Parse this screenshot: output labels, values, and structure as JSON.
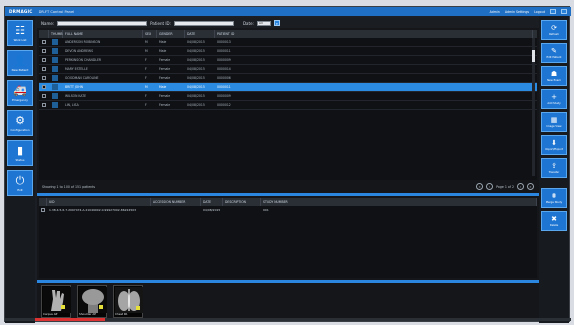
{
  "titlebar": {
    "app": "DRMAGIC",
    "subtitle": "DR-FT Control Panel",
    "right_items": [
      "Admin",
      "Admin Settings",
      "Logout"
    ]
  },
  "left_sidebar": [
    {
      "icon": "worklist-icon",
      "label": "Work List",
      "glyph": "☷"
    },
    {
      "icon": "patient-icon",
      "label": "New Patient",
      "glyph": "👤"
    },
    {
      "icon": "ambulance-icon",
      "label": "Emergency",
      "glyph": "🚑"
    },
    {
      "icon": "gear-icon",
      "label": "Configuration",
      "glyph": "⚙"
    },
    {
      "icon": "status-icon",
      "label": "Status",
      "glyph": "▮"
    },
    {
      "icon": "power-icon",
      "label": "Exit",
      "glyph": "⏻"
    }
  ],
  "right_sidebar": [
    {
      "icon": "refresh-icon",
      "label": "Refresh",
      "glyph": "⟳"
    },
    {
      "icon": "edit-icon",
      "label": "Edit Patient",
      "glyph": "✎"
    },
    {
      "icon": "exam-icon",
      "label": "New Exam",
      "glyph": "☗"
    },
    {
      "icon": "add-icon",
      "label": "Add Study",
      "glyph": "+"
    },
    {
      "icon": "image-icon",
      "label": "Image View",
      "glyph": "▦"
    },
    {
      "icon": "download-icon",
      "label": "Import/Export",
      "glyph": "⬇"
    },
    {
      "icon": "transfer-icon",
      "label": "Transfer",
      "glyph": "⇪"
    },
    {
      "icon": "merge-icon",
      "label": "Merge Study",
      "glyph": "⩩"
    },
    {
      "icon": "delete-icon",
      "label": "Delete",
      "glyph": "✖"
    }
  ],
  "search": {
    "name_label": "Name:",
    "patient_id_label": "Patient ID:",
    "date_label": "Date:",
    "date_value": "All"
  },
  "grid": {
    "columns": [
      "",
      "THUMB",
      "FULL NAME",
      "SEX",
      "GENDER",
      "DATE",
      "PATIENT ID"
    ],
    "rows": [
      {
        "name": "ANDERSON ROBINSON",
        "sex": "M",
        "gender": "Male",
        "date": "04/08/2015",
        "pid": "0000013",
        "selected": false
      },
      {
        "name": "DEVON ANDREWS",
        "sex": "M",
        "gender": "Male",
        "date": "04/08/2015",
        "pid": "0000011",
        "selected": false
      },
      {
        "name": "PERKINSON CHANDLER",
        "sex": "F",
        "gender": "Female",
        "date": "04/08/2015",
        "pid": "0000009",
        "selected": false
      },
      {
        "name": "MARY ESTELLE",
        "sex": "F",
        "gender": "Female",
        "date": "04/08/2015",
        "pid": "0000014",
        "selected": false
      },
      {
        "name": "GOODMAN CAROLINE",
        "sex": "F",
        "gender": "Female",
        "date": "04/08/2015",
        "pid": "0000006",
        "selected": false
      },
      {
        "name": "BRITT JOHN",
        "sex": "M",
        "gender": "Male",
        "date": "04/08/2015",
        "pid": "0000011",
        "selected": true
      },
      {
        "name": "WILSON KATE",
        "sex": "F",
        "gender": "Female",
        "date": "04/08/2015",
        "pid": "0000009",
        "selected": false
      },
      {
        "name": "LIN, LISA",
        "sex": "F",
        "gender": "Female",
        "date": "04/08/2015",
        "pid": "0000012",
        "selected": false
      }
    ]
  },
  "pager": {
    "status": "Showing 1 to 100 of 151 patients",
    "page_text": "Page 1 of 2"
  },
  "studies": {
    "columns": [
      "",
      "UID",
      "ACCESSION NUMBER",
      "DATE",
      "DESCRIPTION",
      "STUDY NUMBER"
    ],
    "rows": [
      {
        "uid": "1.38.4.5.6.7.2097474.A.21049002.0.99927002-86224503",
        "accession": "",
        "date": "04/08/2015",
        "description": "",
        "study": "001"
      }
    ]
  },
  "thumbnails": [
    {
      "label": "Carpus AP"
    },
    {
      "label": "Shoulder AP"
    },
    {
      "label": "Chest PA"
    }
  ]
}
